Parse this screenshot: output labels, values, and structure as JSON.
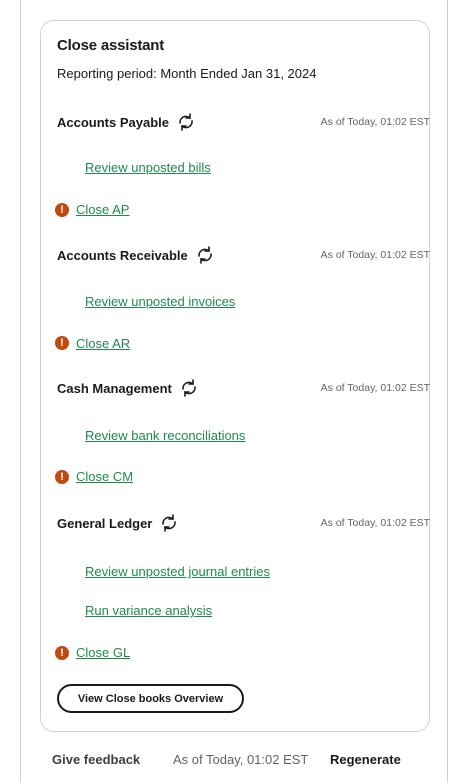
{
  "panel": {
    "title": "Close assistant",
    "reporting_period": "Reporting period: Month Ended Jan 31, 2024"
  },
  "sections": [
    {
      "name": "Accounts Payable",
      "as_of": "As of Today, 01:02 EST",
      "review_links": [
        "Review unposted bills"
      ],
      "close_link": "Close AP"
    },
    {
      "name": "Accounts Receivable",
      "as_of": "As of Today, 01:02 EST",
      "review_links": [
        "Review unposted invoices"
      ],
      "close_link": "Close AR"
    },
    {
      "name": "Cash Management",
      "as_of": "As of Today, 01:02 EST",
      "review_links": [
        "Review bank reconciliations"
      ],
      "close_link": "Close CM"
    },
    {
      "name": "General Ledger",
      "as_of": "As of Today, 01:02 EST",
      "review_links": [
        "Review unposted journal entries",
        "Run variance analysis"
      ],
      "close_link": "Close GL"
    }
  ],
  "overview_button": "View Close books Overview",
  "footer": {
    "feedback": "Give feedback",
    "as_of": "As of Today, 01:02 EST",
    "regenerate": "Regenerate"
  },
  "colors": {
    "link": "#1e8a4c",
    "alert": "#c24a0e",
    "border": "#cfd3d6"
  },
  "icons": {
    "refresh": "refresh-icon",
    "alert": "alert-icon"
  }
}
